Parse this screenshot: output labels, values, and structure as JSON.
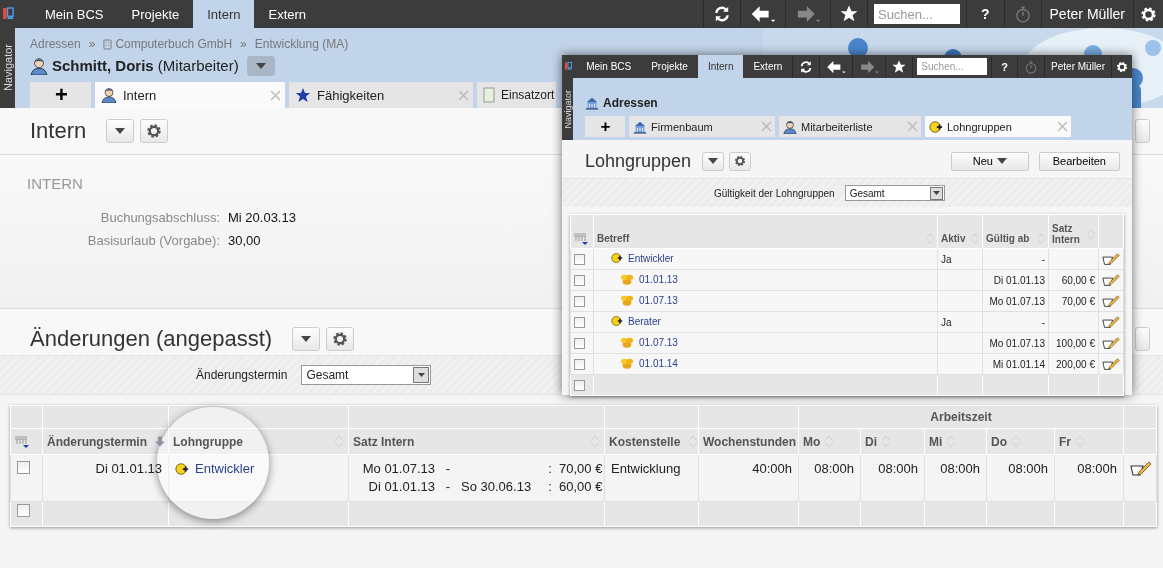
{
  "top_bar": {
    "tabs": [
      {
        "label": "Mein BCS",
        "selected": false
      },
      {
        "label": "Projekte",
        "selected": false
      },
      {
        "label": "Intern",
        "selected": true
      },
      {
        "label": "Extern",
        "selected": false
      }
    ],
    "search": {
      "placeholder": "Suchen..."
    },
    "help": "?",
    "user": "Peter Müller"
  },
  "navigator": "Navigator",
  "breadcrumb": [
    {
      "kind": "link",
      "label": "Adressen"
    },
    {
      "kind": "separator",
      "label": "»"
    },
    {
      "kind": "company",
      "label": "Computerbuch GmbH"
    },
    {
      "kind": "separator",
      "label": "»"
    },
    {
      "kind": "link",
      "label": "Entwicklung (MA)"
    }
  ],
  "record_title": "**Schmitt, Doris** (Mitarbeiter)",
  "record_tabs": [
    {
      "kind": "add",
      "label": "+",
      "selected": false
    },
    {
      "kind": "person",
      "label": "Intern",
      "selected": true
    },
    {
      "kind": "star",
      "label": "Fähigkeiten",
      "selected": false
    },
    {
      "kind": "page",
      "label": "Einsatzort",
      "selected": false
    }
  ],
  "intern": {
    "title": "Intern",
    "heading": "INTERN",
    "fields": [
      {
        "label": "Buchungsabschluss:",
        "value": "Mi 20.03.13"
      },
      {
        "label": "Basisurlaub (Vorgabe):",
        "value": "30,00"
      }
    ]
  },
  "changes": {
    "title": "Änderungen (angepasst)",
    "filter": {
      "label": "Änderungstermin",
      "value": "Gesamt"
    },
    "table": {
      "group_header": "Arbeitszeit",
      "columns": [
        {
          "label": "Änderungstermin",
          "sorted": true
        },
        {
          "label": "Lohngruppe",
          "sortable": true,
          "sorted": false
        },
        {
          "label": "Satz Intern",
          "sortable": true,
          "sorted": false
        },
        {
          "label": "Kostenstelle",
          "sortable": true,
          "sorted": false
        },
        {
          "label": "Wochenstunden"
        }
      ],
      "day_columns": [
        {
          "label": "Mo",
          "sortable": true,
          "sorted": false
        },
        {
          "label": "Di",
          "sortable": true,
          "sorted": false
        },
        {
          "label": "Mi",
          "sortable": true,
          "sorted": false
        },
        {
          "label": "Do",
          "sortable": true,
          "sorted": false
        },
        {
          "label": "Fr",
          "sortable": true,
          "sorted": false
        }
      ],
      "rows": [
        {
          "checked": false,
          "date": "Di 01.01.13",
          "wage_group": "Entwickler",
          "rates": [
            {
              "from": "Mo 01.07.13",
              "dash": "-",
              "colon": ":",
              "amount": "70,00 €"
            },
            {
              "from": "Di 01.01.13",
              "dash": "-",
              "to": "So 30.06.13",
              "colon": ":",
              "amount": "60,00 €"
            }
          ],
          "cost_center": "Entwicklung",
          "weekly_hours": "40:00h",
          "days": [
            "08:00h",
            "08:00h",
            "08:00h",
            "08:00h",
            "08:00h"
          ]
        }
      ],
      "footer_checked": false
    }
  },
  "inset_window": {
    "top_bar": {
      "tabs": [
        {
          "label": "Mein BCS",
          "selected": false
        },
        {
          "label": "Projekte",
          "selected": false
        },
        {
          "label": "Intern",
          "selected": true
        },
        {
          "label": "Extern",
          "selected": false
        }
      ],
      "search": {
        "placeholder": "Suchen..."
      },
      "help": "?",
      "user": "Peter Müller"
    },
    "navigator": "Navigator",
    "header": "Adressen",
    "tabs": [
      {
        "kind": "add",
        "label": "+",
        "selected": false
      },
      {
        "kind": "building",
        "label": "Firmenbaum",
        "selected": false
      },
      {
        "kind": "person",
        "label": "Mitarbeiterliste",
        "selected": false
      },
      {
        "kind": "coin",
        "label": "Lohngruppen",
        "selected": true
      }
    ],
    "title": "Lohngruppen",
    "buttons": [
      {
        "kind": "menu",
        "label": "Neu"
      },
      {
        "kind": "plain",
        "label": "Bearbeiten"
      }
    ],
    "filter": {
      "label": "Gültigkeit der Lohngruppen",
      "value": "Gesamt"
    },
    "table": {
      "columns": [
        {
          "label": "Betreff",
          "sortable": true,
          "sorted": false
        },
        {
          "label": "Aktiv",
          "sortable": true,
          "sorted": false
        },
        {
          "label": "Gültig ab",
          "sortable": true,
          "sorted": false
        },
        {
          "label": "Satz Intern",
          "sortable": true,
          "sorted": false
        }
      ],
      "rows": [
        {
          "checked": false,
          "label": "Entwickler",
          "active": "Ja",
          "valid_from": "-",
          "children": [
            {
              "checked": false,
              "label": "01.01.13",
              "valid_from": "Di 01.01.13",
              "rate": "60,00 €"
            },
            {
              "checked": false,
              "label": "01.07.13",
              "valid_from": "Mo 01.07.13",
              "rate": "70,00 €"
            }
          ]
        },
        {
          "checked": false,
          "label": "Berater",
          "active": "Ja",
          "valid_from": "-",
          "children": [
            {
              "checked": false,
              "label": "01.07.13",
              "valid_from": "Mo 01.07.13",
              "rate": "100,00 €"
            },
            {
              "checked": false,
              "label": "01.01.14",
              "valid_from": "Mi 01.01.14",
              "rate": "200,00 €"
            }
          ]
        }
      ],
      "footer_checked": false
    }
  }
}
